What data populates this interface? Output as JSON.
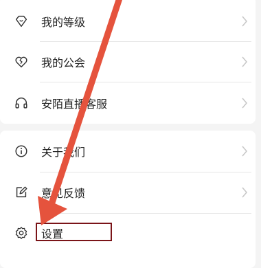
{
  "group1": {
    "items": [
      {
        "label": "我的等级",
        "icon": "diamond-heart-icon"
      },
      {
        "label": "我的公会",
        "icon": "broken-heart-icon"
      },
      {
        "label": "安陌直播客服",
        "icon": "headphones-icon"
      }
    ]
  },
  "group2": {
    "items": [
      {
        "label": "关于我们",
        "icon": "info-icon"
      },
      {
        "label": "意见反馈",
        "icon": "edit-icon"
      },
      {
        "label": "设置",
        "icon": "gear-icon"
      }
    ]
  },
  "annotation": {
    "arrow_color": "#e5533d",
    "box_color": "#7a1418"
  }
}
